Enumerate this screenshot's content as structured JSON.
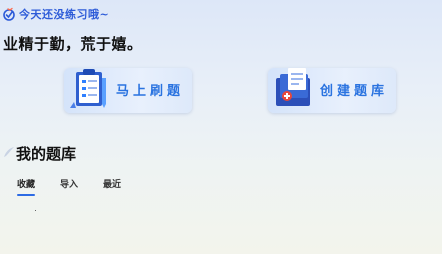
{
  "header": {
    "greeting": "今天还没练习哦~",
    "motto": "业精于勤，荒于嬉。"
  },
  "actions": [
    {
      "id": "start",
      "label": "马上刷题",
      "icon": "clipboard-pencil-icon"
    },
    {
      "id": "create",
      "label": "创建题库",
      "icon": "stacked-book-icon"
    }
  ],
  "library": {
    "title": "我的题库",
    "tabs": [
      {
        "label": "收藏",
        "active": true
      },
      {
        "label": "导入",
        "active": false
      },
      {
        "label": "最近",
        "active": false
      }
    ]
  },
  "colors": {
    "accent": "#2d6be4",
    "action_label": "#2a73e0",
    "greeting": "#2d5bd8"
  }
}
